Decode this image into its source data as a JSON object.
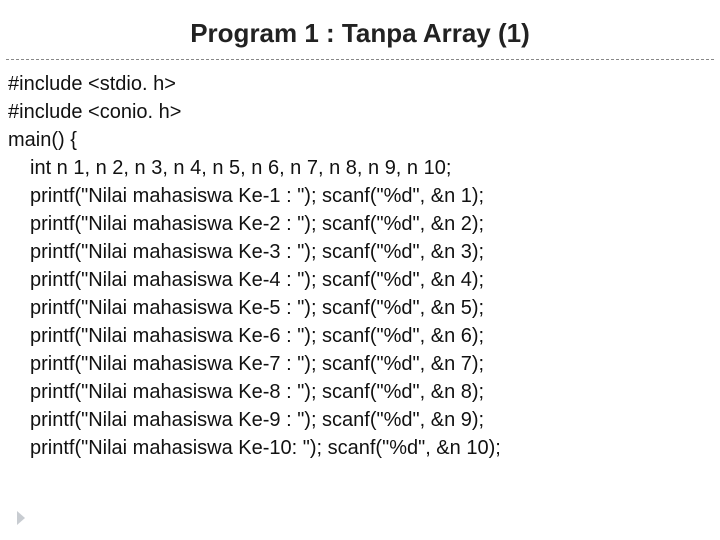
{
  "title": "Program 1 : Tanpa Array (1)",
  "code": {
    "l1": "#include <stdio. h>",
    "l2": "#include <conio. h>",
    "l3": "main() {",
    "l4": "int n 1, n 2, n 3, n 4, n 5, n 6, n 7, n 8, n 9, n 10;",
    "l5": "printf(\"Nilai mahasiswa Ke-1 : \"); scanf(\"%d\", &n 1);",
    "l6": "printf(\"Nilai mahasiswa Ke-2 : \"); scanf(\"%d\", &n 2);",
    "l7": "printf(\"Nilai mahasiswa Ke-3 : \"); scanf(\"%d\", &n 3);",
    "l8": "printf(\"Nilai mahasiswa Ke-4 : \"); scanf(\"%d\", &n 4);",
    "l9": "printf(\"Nilai mahasiswa Ke-5 : \"); scanf(\"%d\", &n 5);",
    "l10": "printf(\"Nilai mahasiswa Ke-6 : \"); scanf(\"%d\", &n 6);",
    "l11": "printf(\"Nilai mahasiswa Ke-7 : \"); scanf(\"%d\", &n 7);",
    "l12": "printf(\"Nilai mahasiswa Ke-8 : \"); scanf(\"%d\", &n 8);",
    "l13": "printf(\"Nilai mahasiswa Ke-9 : \"); scanf(\"%d\", &n 9);",
    "l14": "printf(\"Nilai mahasiswa Ke-10: \"); scanf(\"%d\", &n 10);"
  }
}
